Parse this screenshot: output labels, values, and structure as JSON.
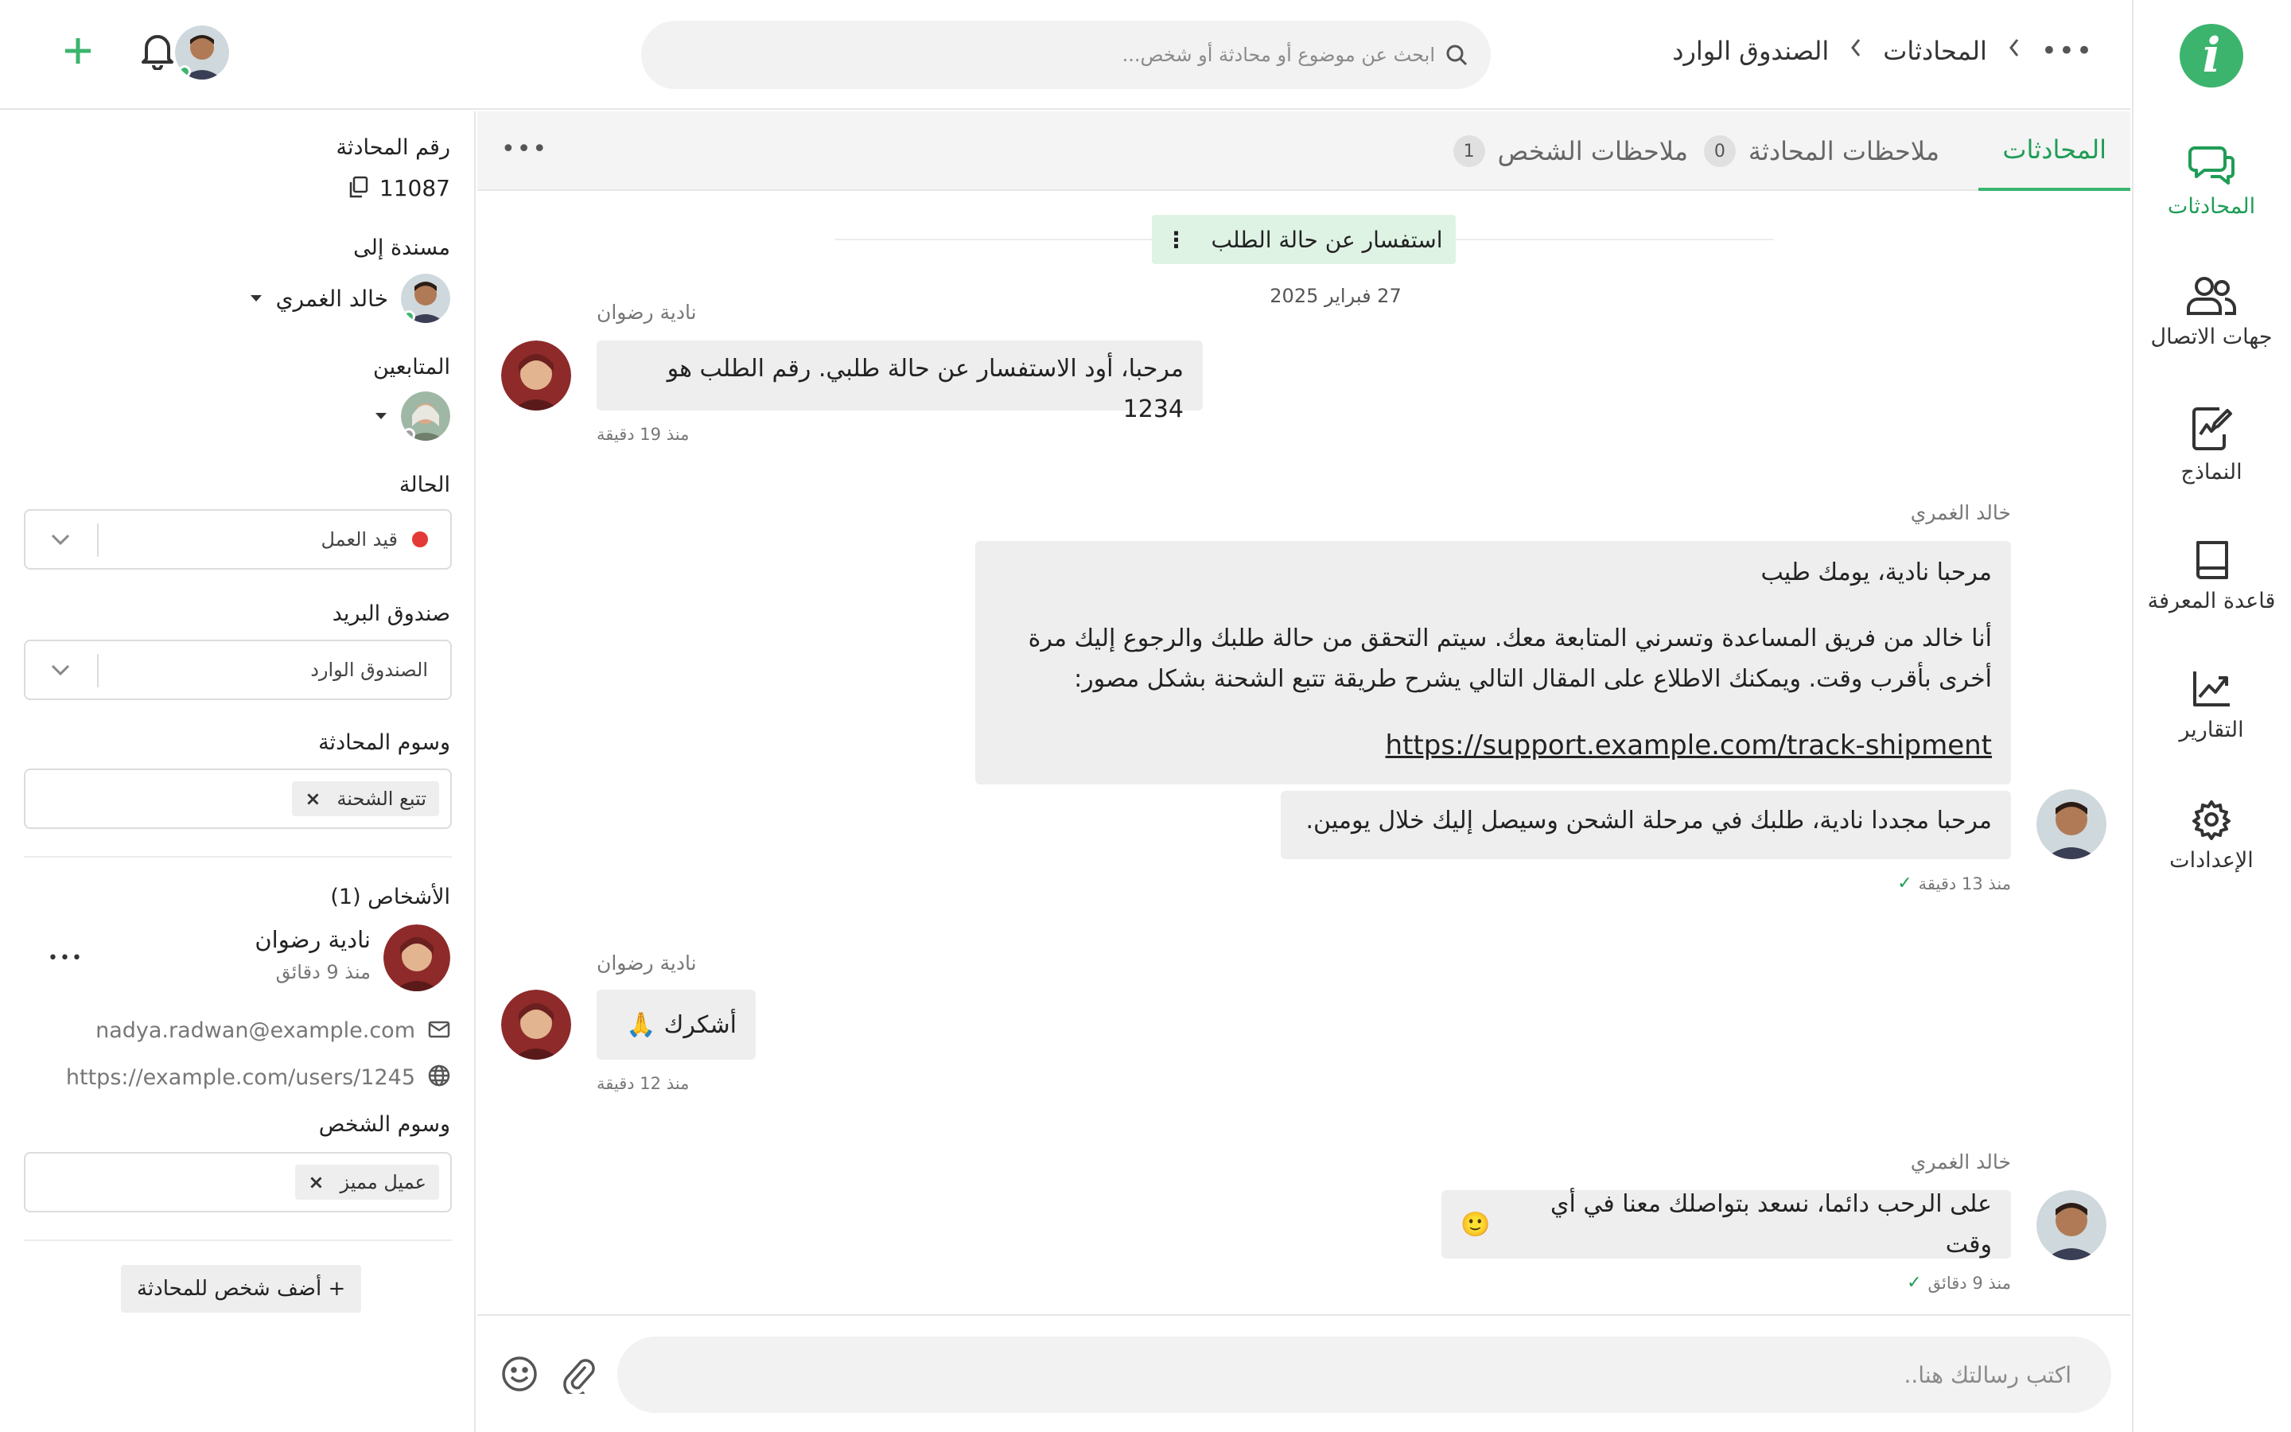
{
  "app": {
    "logo_letter": "i",
    "brand_color": "#3cb46e"
  },
  "nav": {
    "items": [
      {
        "label": "المحادثات",
        "icon": "chat-bubbles-icon",
        "active": true
      },
      {
        "label": "جهات الاتصال",
        "icon": "contacts-icon",
        "active": false
      },
      {
        "label": "النماذج",
        "icon": "templates-icon",
        "active": false
      },
      {
        "label": "قاعدة المعرفة",
        "icon": "book-icon",
        "active": false
      },
      {
        "label": "التقارير",
        "icon": "reports-chart-icon",
        "active": false
      },
      {
        "label": "الإعدادات",
        "icon": "gear-icon",
        "active": false
      }
    ]
  },
  "header": {
    "breadcrumb": [
      "المحادثات",
      "الصندوق الوارد"
    ],
    "search_placeholder": "ابحث عن موضوع أو محادثة أو شخص..."
  },
  "tabs": [
    {
      "label": "المحادثات",
      "active": true
    },
    {
      "label": "ملاحظات المحادثة",
      "count": "0"
    },
    {
      "label": "ملاحظات الشخص",
      "count": "1"
    }
  ],
  "conversation": {
    "subject": "استفسار عن حالة الطلب",
    "date": "27 فبراير 2025",
    "messages": [
      {
        "sender": "نادية رضوان",
        "text": "مرحبا، أود الاستفسار عن حالة طلبي. رقم الطلب هو 1234",
        "time": "منذ 19 دقيقة"
      },
      {
        "sender": "خالد الغمري",
        "line1": "مرحبا نادية، يومك طيب",
        "line2": "أنا خالد من فريق المساعدة وتسرني المتابعة معك. سيتم التحقق من حالة طلبك والرجوع إليك مرة",
        "line3": "أخرى بأقرب وقت. ويمكنك الاطلاع على المقال التالي يشرح طريقة تتبع الشحنة بشكل مصور:",
        "link": "https://support.example.com/track-shipment",
        "text2": "مرحبا مجددا نادية، طلبك في مرحلة الشحن وسيصل إليك خلال يومين.",
        "time": "منذ 13 دقيقة"
      },
      {
        "sender": "نادية رضوان",
        "text": "أشكرك",
        "emoji": "🙏",
        "time": "منذ 12 دقيقة"
      },
      {
        "sender": "خالد الغمري",
        "text": "على الرحب دائما، نسعد بتواصلك معنا في أي وقت",
        "emoji": "🙂",
        "time": "منذ 9 دقائق"
      }
    ]
  },
  "composer": {
    "placeholder": "اكتب رسالتك هنا.."
  },
  "details": {
    "id_label": "رقم المحادثة",
    "id_value": "11087",
    "assignee_label": "مسندة إلى",
    "assignee_name": "خالد الغمري",
    "followers_label": "المتابعين",
    "status_label": "الحالة",
    "status_value": "قيد العمل",
    "status_color": "#e53935",
    "mailbox_label": "صندوق البريد",
    "mailbox_value": "الصندوق الوارد",
    "conv_tags_label": "وسوم المحادثة",
    "conv_tag": "تتبع الشحنة",
    "people_label": "الأشخاص (1)",
    "person_name": "نادية رضوان",
    "person_time": "منذ 9 دقائق",
    "person_email": "nadya.radwan@example.com",
    "person_url": "https://example.com/users/1245",
    "person_tags_label": "وسوم الشخص",
    "person_tag": "عميل مميز",
    "add_person": "+ أضف شخص للمحادثة"
  }
}
